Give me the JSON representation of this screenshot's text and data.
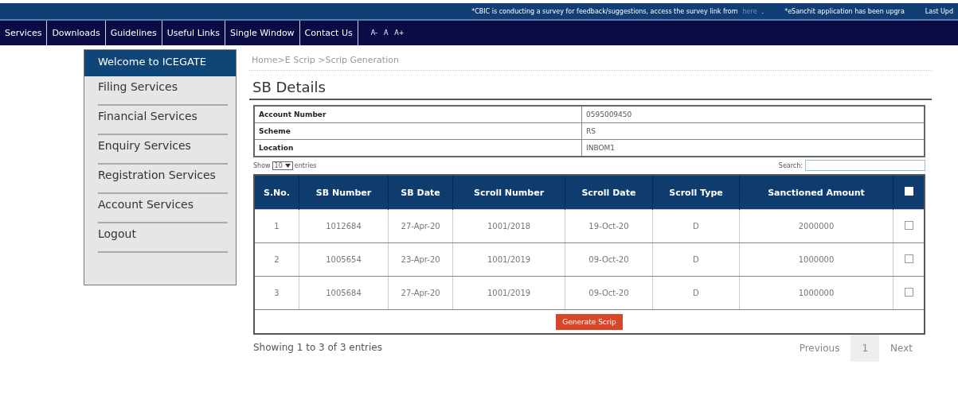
{
  "ticker": {
    "parts": [
      {
        "kind": "text",
        "text": "*CBIC is conducting a survey for feedback/suggestions, access the survey link from"
      },
      {
        "kind": "link",
        "text": "here"
      },
      {
        "kind": "text",
        "text": "."
      },
      {
        "kind": "text",
        "text": "*eSanchit application has been upgra"
      },
      {
        "kind": "text",
        "text": "Last Upd"
      }
    ]
  },
  "nav": {
    "items": [
      "Services",
      "Downloads",
      "Guidelines",
      "Useful Links",
      "Single Window",
      "Contact Us"
    ],
    "font_sizes": [
      "A-",
      "A",
      "A+"
    ]
  },
  "sidebar": {
    "header": "Welcome to ICEGATE",
    "items": [
      "Filing Services",
      "Financial Services",
      "Enquiry Services",
      "Registration Services",
      "Account Services",
      "Logout"
    ]
  },
  "breadcrumb": "Home>E Scrip >Scrip Generation",
  "heading": "SB Details",
  "details": [
    {
      "label": "Account Number",
      "value": "0595009450"
    },
    {
      "label": "Scheme",
      "value": "RS"
    },
    {
      "label": "Location",
      "value": "INBOM1"
    }
  ],
  "length_control": {
    "before": "Show",
    "value": "10",
    "after": "entries"
  },
  "search": {
    "label": "Search:"
  },
  "table": {
    "columns": [
      "S.No.",
      "SB Number",
      "SB Date",
      "Scroll Number",
      "Scroll Date",
      "Scroll Type",
      "Sanctioned Amount"
    ],
    "select_all": {
      "checked": false
    },
    "rows": [
      {
        "cells": [
          "1",
          "1012684",
          "27-Apr-20",
          "1001/2018",
          "19-Oct-20",
          "D",
          "2000000"
        ],
        "checked": false
      },
      {
        "cells": [
          "2",
          "1005654",
          "23-Apr-20",
          "1001/2019",
          "09-Oct-20",
          "D",
          "1000000"
        ],
        "checked": false
      },
      {
        "cells": [
          "3",
          "1005684",
          "27-Apr-20",
          "1001/2019",
          "09-Oct-20",
          "D",
          "1000000"
        ],
        "checked": false
      }
    ]
  },
  "generate_button": "Generate Scrip",
  "info": "Showing 1 to 3 of 3 entries",
  "pagination": [
    {
      "label": "Previous",
      "selected": false
    },
    {
      "label": "1",
      "selected": true
    },
    {
      "label": "Next",
      "selected": false
    }
  ]
}
